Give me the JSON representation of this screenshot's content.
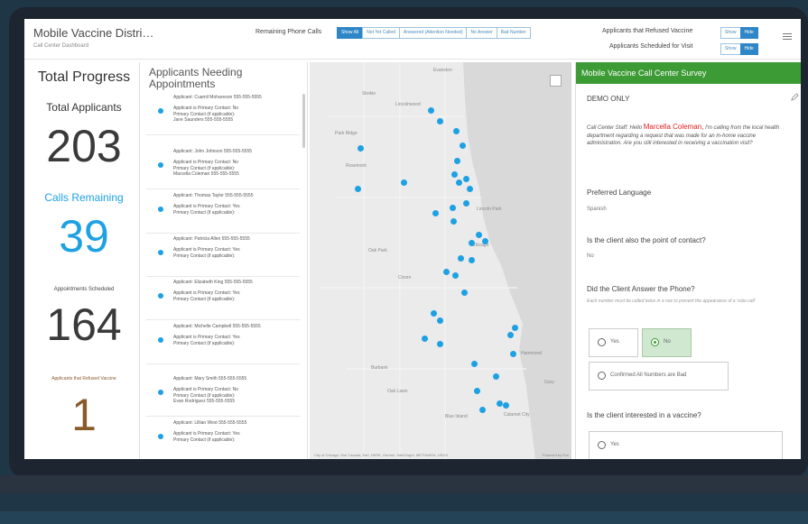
{
  "header": {
    "title": "Mobile Vaccine Distri…",
    "subtitle": "Call Center Dashboard",
    "filter_label": "Remaining Phone Calls",
    "filter_buttons": [
      "Show All",
      "Not Yet Called",
      "Answered (Attention Needed)",
      "No Answer",
      "Bad Number"
    ],
    "refused_label": "Applicants that Refused Vaccine",
    "scheduled_label": "Applicants Scheduled for Visit",
    "show_label": "Show",
    "hide_label": "Hide",
    "active_color": "#2e86c6"
  },
  "progress": {
    "title": "Total Progress",
    "total_label": "Total Applicants",
    "total_value": "203",
    "calls_label": "Calls Remaining",
    "calls_value": "39",
    "appt_label": "Appointments Scheduled",
    "appt_value": "164",
    "refused_label": "Applicants that Refused Vaccine",
    "refused_value": "1",
    "calls_color": "#1ea1e3",
    "refused_color": "#8a5a2b"
  },
  "list": {
    "title": "Applicants Needing Appointments",
    "items": [
      {
        "header": "Applicant: Cuamil Mohareson 555-555-5555",
        "body": "Applicant is Primary Contact: No\nPrimary Contact (if applicable):\nJane Saunders 555-555-5555"
      },
      {
        "header": "Applicant: John Johnson 555-555-5555",
        "body": "Applicant is Primary Contact: No\nPrimary Contact (if applicable):\nMarcella Coleman 555-555-5555"
      },
      {
        "header": "Applicant: Thomas Taylor 555-555-5555",
        "body": "Applicant is Primary Contact: Yes\nPrimary Contact (if applicable):"
      },
      {
        "header": "Applicant: Patricia Allen 555-555-5555",
        "body": "Applicant is Primary Contact: Yes\nPrimary Contact (if applicable):"
      },
      {
        "header": "Applicant: Elizabeth King 555-555-5555",
        "body": "Applicant is Primary Contact: Yes\nPrimary Contact (if applicable):"
      },
      {
        "header": "Applicant: Michelle Campbell 555-555-5555",
        "body": "Applicant is Primary Contact: Yes\nPrimary Contact (if applicable):"
      },
      {
        "header": "Applicant: Mary Smith 555-555-5555",
        "body": "Applicant is Primary Contact: No\nPrimary Contact (if applicable):\nEvan Rodriguez 555-555-5555"
      },
      {
        "header": "Applicant: Lillian West 555-555-5555",
        "body": "Applicant is Primary Contact: Yes\nPrimary Contact (if applicable):"
      }
    ]
  },
  "map": {
    "places": [
      "Evanston",
      "Skokie",
      "Lincolnwood",
      "Park Ridge",
      "Rosemont",
      "Oak Park",
      "Cicero",
      "Chicago",
      "Lincoln Park",
      "Burbank",
      "Oak Lawn",
      "Blue Island",
      "Calumet City",
      "Hammond",
      "Gary"
    ],
    "attribution": "City of Chicago, Esri Canada, Esri, HERE, Garmin, SafeGraph, METI/NASA, USGS",
    "powered_by": "Powered by Esri"
  },
  "survey": {
    "header": "Mobile Vaccine Call Center Survey",
    "demo": "DEMO ONLY",
    "intro_prefix": "Call Center Staff: Hello",
    "intro_name": "Marcella Coleman,",
    "intro_suffix": "I'm calling from the local health department regarding a request that was made for an in-home vaccine administration. Are you still interested in receiving a vaccination visit?",
    "q1": "Preferred Language",
    "a1": "Spanish",
    "q2": "Is the client also the point of contact?",
    "a2": "No",
    "q3": "Did the Client Answer the Phone?",
    "q3_hint": "Each number must be called twice in a row to prevent the appearance of a 'robo call'",
    "yes": "Yes",
    "no": "No",
    "bad_numbers": "Confirmed All Numbers are Bad",
    "q4": "Is the client interested in a vaccine?",
    "accent_color": "#3d9b35"
  }
}
